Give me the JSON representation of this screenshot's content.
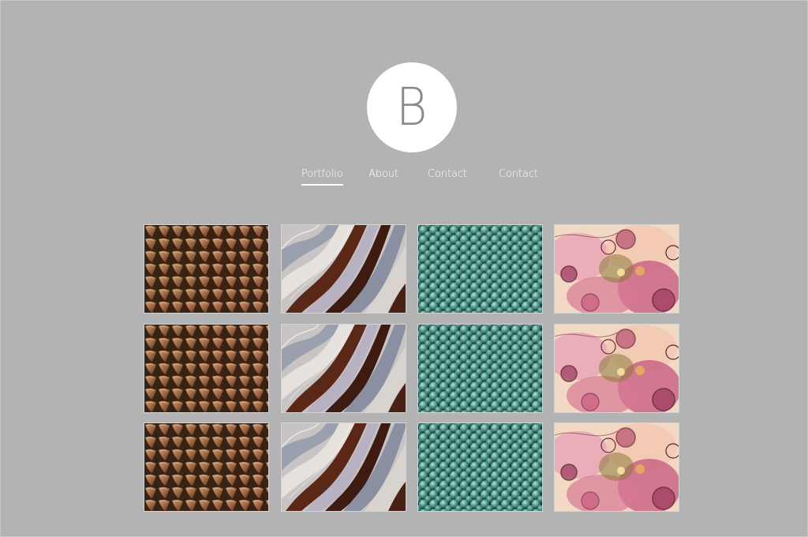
{
  "site": {
    "logo_letter": "B"
  },
  "nav": {
    "items": [
      {
        "label": "Portfolio",
        "active": true
      },
      {
        "label": "About",
        "active": false
      },
      {
        "label": "Contact",
        "active": false
      },
      {
        "label": "Contact",
        "active": false
      }
    ]
  },
  "gallery": {
    "rows": 3,
    "columns": [
      {
        "texture": "bronze-scales"
      },
      {
        "texture": "marbled-stripes"
      },
      {
        "texture": "teal-beads"
      },
      {
        "texture": "pink-alcohol-ink"
      }
    ]
  },
  "colors": {
    "background": "#b3b3b3",
    "logo_circle": "#ffffff",
    "logo_letter": "#8a8a8a",
    "nav_text": "#ffffff"
  }
}
